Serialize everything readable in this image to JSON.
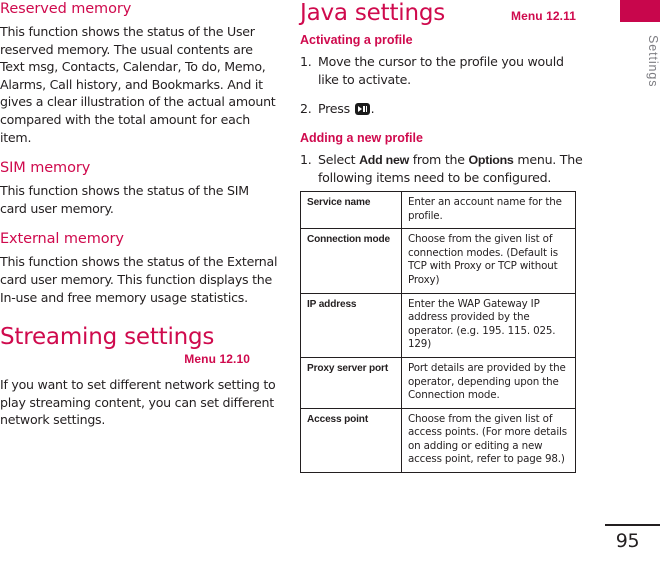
{
  "edge": {
    "tab_label": "Settings"
  },
  "footer": {
    "page_number": "95"
  },
  "left_column": {
    "sections": [
      {
        "heading": "Reserved memory",
        "body": "This function shows the status of the User reserved memory. The usual contents are Text msg, Contacts, Calendar, To do, Memo, Alarms, Call history, and Bookmarks. And it gives a clear illustration of the actual amount compared with the total amount for each item."
      },
      {
        "heading": "SIM memory",
        "body": "This function shows the status of the SIM card user memory."
      },
      {
        "heading": "External memory",
        "body": "This function shows the status of the External card user memory. This function displays the In-use and free memory usage statistics."
      }
    ],
    "streaming": {
      "title": "Streaming settings",
      "menu_ref": "Menu 12.10",
      "body": "If you want to set different network setting to play streaming content, you can set different network settings."
    }
  },
  "right_column": {
    "title": "Java settings",
    "menu_ref": "Menu 12.11",
    "activating": {
      "heading": "Activating a profile",
      "steps": [
        {
          "num": "1.",
          "text": "Move the cursor to the profile you would like to activate."
        },
        {
          "num": "2.",
          "text_before": "Press ",
          "icon": "play-pause-key-icon",
          "text_after": "."
        }
      ]
    },
    "adding": {
      "heading": "Adding a new profile",
      "step": {
        "num": "1.",
        "part1": "Select ",
        "bold1": "Add new",
        "part2": " from the ",
        "bold2": "Options",
        "part3": " menu. The following items need to be configured."
      }
    },
    "table": {
      "rows": [
        {
          "key": "Service name",
          "value": "Enter an account name for the profile."
        },
        {
          "key": "Connection mode",
          "value": "Choose from the given list of connection modes. (Default is TCP with Proxy or TCP without Proxy)"
        },
        {
          "key": "IP address",
          "value": "Enter the WAP Gateway IP address provided by the operator. (e.g. 195. 115. 025. 129)"
        },
        {
          "key": "Proxy server port",
          "value": "Port details are provided by the operator, depending upon the Connection mode."
        },
        {
          "key": "Access point",
          "value": "Choose from the given list of access points. (For more details on adding or editing a new access point, refer to page 98.)"
        }
      ]
    }
  },
  "colors": {
    "accent": "#cf0a4d",
    "tab": "#c8064c",
    "text": "#231f20",
    "edge_label": "#7d7d82"
  }
}
